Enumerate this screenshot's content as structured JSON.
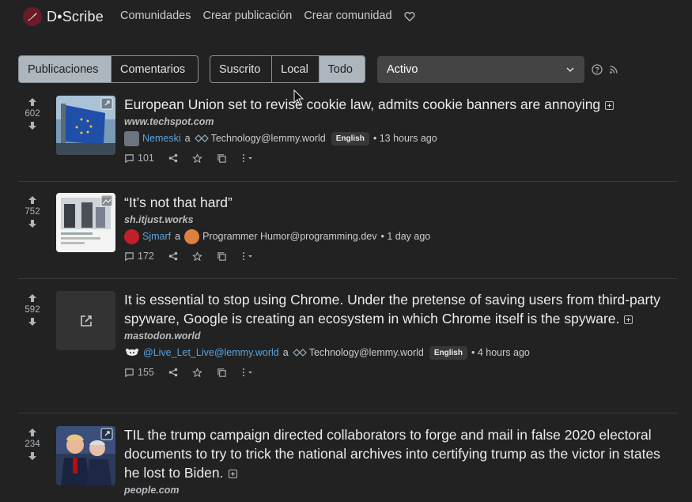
{
  "navbar": {
    "brand": "D•Scribe",
    "links": [
      "Comunidades",
      "Crear publicación",
      "Crear comunidad"
    ]
  },
  "filters": {
    "type": {
      "options": [
        "Publicaciones",
        "Comentarios"
      ],
      "selected": "Publicaciones"
    },
    "listing": {
      "options": [
        "Suscrito",
        "Local",
        "Todo"
      ],
      "selected": "Todo"
    },
    "sort": "Activo"
  },
  "connector": "a",
  "posts": [
    {
      "score": "602",
      "title": "European Union set to revise cookie law, admits cookie banners are annoying",
      "domain": "www.techspot.com",
      "user": "Nemeski",
      "community": "Technology@lemmy.world",
      "language": "English",
      "time": "• 13 hours ago",
      "comments": "101"
    },
    {
      "score": "752",
      "title": "“It’s not that hard”",
      "domain": "sh.itjust.works",
      "user": "Sjmarf",
      "community": "Programmer Humor@programming.dev",
      "language": "",
      "time": "• 1 day ago",
      "comments": "172"
    },
    {
      "score": "592",
      "title": "It is essential to stop using Chrome. Under the pretense of saving users from third-party spyware, Google is creating an ecosystem in which Chrome itself is the spyware.",
      "domain": "mastodon.world",
      "user": "@Live_Let_Live@lemmy.world",
      "community": "Technology@lemmy.world",
      "language": "English",
      "time": "• 4 hours ago",
      "comments": "155"
    },
    {
      "score": "234",
      "title": "TIL the trump campaign directed collaborators to forge and mail in false 2020 electoral documents to try to trick the national archives into certifying trump as the victor in states he lost to Biden.",
      "domain": "people.com"
    }
  ],
  "colors": {
    "background": "#222222",
    "accent": "#adb5bd",
    "user_link": "#5ba3dc",
    "brand": "#6b1a2a"
  }
}
